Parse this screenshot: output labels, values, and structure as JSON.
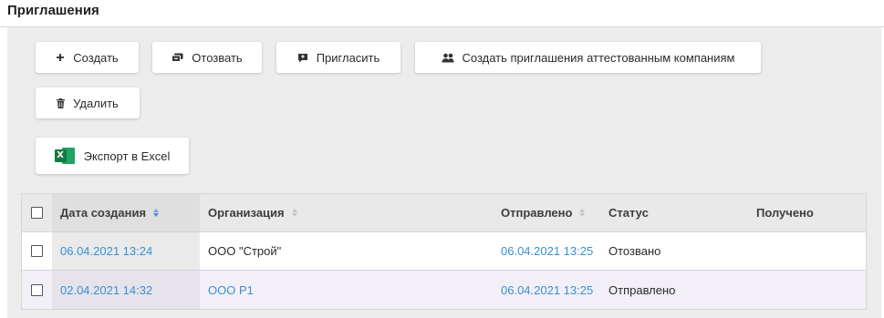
{
  "page": {
    "title": "Приглашения"
  },
  "toolbar": {
    "create_label": "Создать",
    "revoke_label": "Отозвать",
    "invite_label": "Пригласить",
    "invite_certified_label": "Создать приглашения аттестованным компаниям",
    "delete_label": "Удалить",
    "export_label": "Экспорт в Excel",
    "icons": [
      "plus-icon",
      "revoke-icon",
      "invite-icon",
      "users-icon",
      "trash-icon",
      "excel-icon"
    ]
  },
  "table": {
    "columns": {
      "created": "Дата создания",
      "organization": "Организация",
      "sent": "Отправлено",
      "status": "Статус",
      "received": "Получено"
    },
    "sort": {
      "column": "created",
      "direction": "desc"
    },
    "rows": [
      {
        "created": "06.04.2021 13:24",
        "organization": "ООО \"Строй\"",
        "organization_is_link": false,
        "sent": "06.04.2021 13:25",
        "status": "Отозвано",
        "received": ""
      },
      {
        "created": "02.04.2021 14:32",
        "organization": "ООО Р1",
        "organization_is_link": true,
        "sent": "06.04.2021 13:25",
        "status": "Отправлено",
        "received": ""
      }
    ]
  },
  "colors": {
    "accent_link": "#3a8fd6",
    "panel_bg": "#ececec",
    "excel_green": "#107c41"
  }
}
